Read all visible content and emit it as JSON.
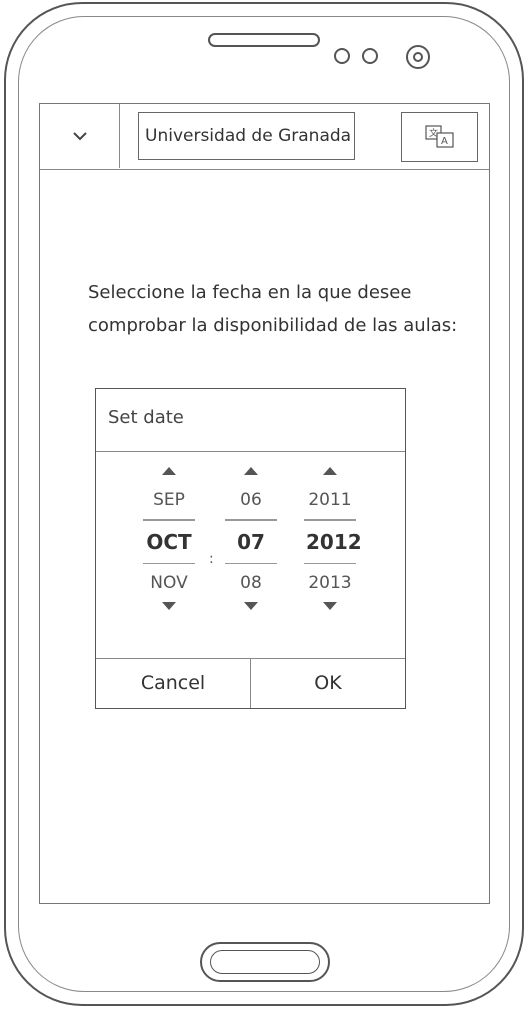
{
  "header": {
    "menu_icon": "chevron-down-icon",
    "title": "Universidad de Granada",
    "translate_icon": "translate-icon"
  },
  "main": {
    "prompt_line1": "Seleccione la fecha en la que desee",
    "prompt_line2": "comprobar la disponibilidad de las aulas:"
  },
  "date_dialog": {
    "title": "Set date",
    "month": {
      "prev": "SEP",
      "selected": "OCT",
      "next": "NOV"
    },
    "day": {
      "prev": "06",
      "selected": "07",
      "next": "08"
    },
    "year": {
      "prev": "2011",
      "selected": "2012",
      "next": "2013"
    },
    "separator": ":",
    "cancel_label": "Cancel",
    "ok_label": "OK"
  }
}
